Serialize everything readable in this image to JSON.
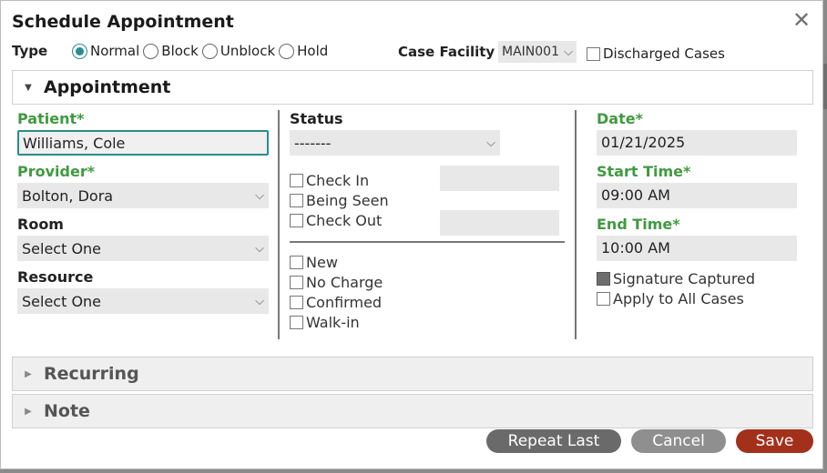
{
  "dialog": {
    "title": "Schedule Appointment"
  },
  "type_row": {
    "label": "Type",
    "options": [
      "Normal",
      "Block",
      "Unblock",
      "Hold"
    ],
    "selected": "Normal"
  },
  "facility": {
    "label": "Case Facility",
    "value": "MAIN001"
  },
  "discharged": {
    "label": "Discharged Cases",
    "checked": false
  },
  "sections": {
    "appointment": "Appointment",
    "recurring": "Recurring",
    "note": "Note"
  },
  "patient": {
    "label": "Patient*",
    "value": "Williams, Cole"
  },
  "provider": {
    "label": "Provider*",
    "value": "Bolton, Dora"
  },
  "room": {
    "label": "Room",
    "value": "Select One"
  },
  "resource": {
    "label": "Resource",
    "value": "Select One"
  },
  "status": {
    "label": "Status",
    "value": "-------"
  },
  "status_checks": [
    "Check In",
    "Being Seen",
    "Check Out"
  ],
  "flags": [
    "New",
    "No Charge",
    "Confirmed",
    "Walk-in"
  ],
  "date": {
    "label": "Date*",
    "value": "01/21/2025"
  },
  "start_time": {
    "label": "Start Time*",
    "value": "09:00 AM"
  },
  "end_time": {
    "label": "End Time*",
    "value": "10:00 AM"
  },
  "signature": {
    "label": "Signature Captured",
    "checked": true
  },
  "apply_all": {
    "label": "Apply to All Cases",
    "checked": false
  },
  "buttons": {
    "repeat_last": "Repeat Last",
    "cancel": "Cancel",
    "save": "Save"
  },
  "colors": {
    "accent": "#2a8c8c",
    "required": "#3f9a3f",
    "save": "#a3301b"
  }
}
